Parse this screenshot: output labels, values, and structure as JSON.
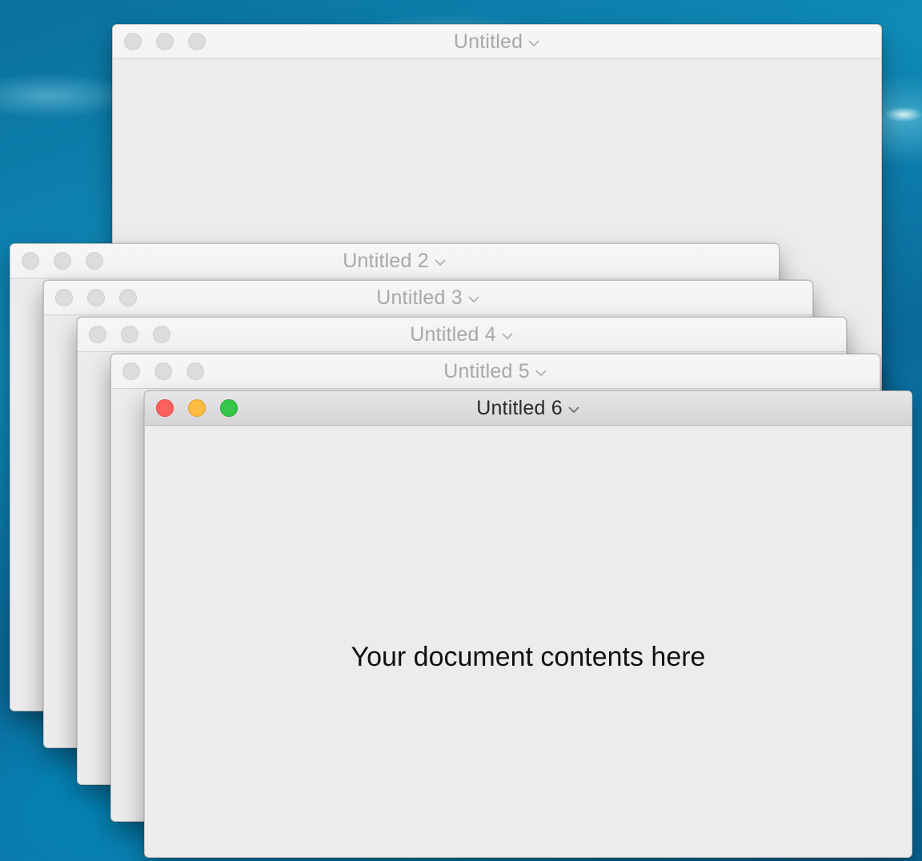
{
  "windows": [
    {
      "title": "Untitled",
      "active": false
    },
    {
      "title": "Untitled 2",
      "active": false
    },
    {
      "title": "Untitled 3",
      "active": false
    },
    {
      "title": "Untitled 4",
      "active": false
    },
    {
      "title": "Untitled 5",
      "active": false
    },
    {
      "title": "Untitled 6",
      "active": true,
      "content": "Your document contents here"
    }
  ],
  "colors": {
    "close": "#fc605c",
    "minimize": "#fdbc40",
    "zoom": "#34c84a",
    "inactive_button": "#dcdcdc",
    "window_background": "#ececec"
  },
  "icons": {
    "title_chevron": "chevron-down-icon"
  }
}
